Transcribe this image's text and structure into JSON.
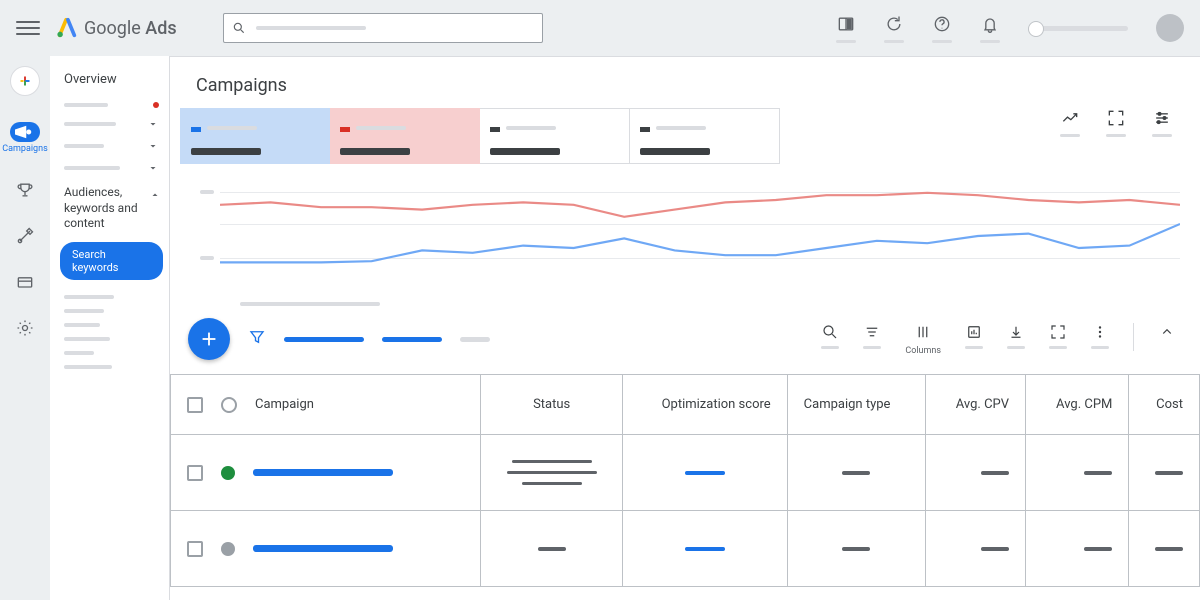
{
  "brand": {
    "google": "Google",
    "ads": "Ads"
  },
  "sidebar": {
    "overview": "Overview",
    "campaigns_label": "Campaigns",
    "akc": "Audiences, keywords and content",
    "chip": "Search keywords"
  },
  "page": {
    "title": "Campaigns"
  },
  "table": {
    "headers": {
      "campaign": "Campaign",
      "status": "Status",
      "opt": "Optimization score",
      "type": "Campaign type",
      "cpv": "Avg. CPV",
      "cpm": "Avg. CPM",
      "cost": "Cost"
    }
  },
  "toolbar": {
    "columns_label": "Columns"
  },
  "chart_data": {
    "type": "line",
    "x": [
      0,
      1,
      2,
      3,
      4,
      5,
      6,
      7,
      8,
      9,
      10,
      11,
      12,
      13,
      14,
      15,
      16,
      17,
      18,
      19
    ],
    "series": [
      {
        "name": "metric_blue",
        "color": "#6fa8f5",
        "values": [
          72,
          72,
          72,
          71,
          62,
          64,
          58,
          60,
          52,
          62,
          66,
          66,
          60,
          54,
          56,
          50,
          48,
          60,
          58,
          40
        ]
      },
      {
        "name": "metric_red",
        "color": "#ea8a86",
        "values": [
          24,
          22,
          26,
          26,
          28,
          24,
          22,
          24,
          34,
          28,
          22,
          20,
          16,
          16,
          14,
          16,
          20,
          22,
          20,
          24
        ]
      }
    ],
    "ylim": [
      0,
      100
    ]
  }
}
